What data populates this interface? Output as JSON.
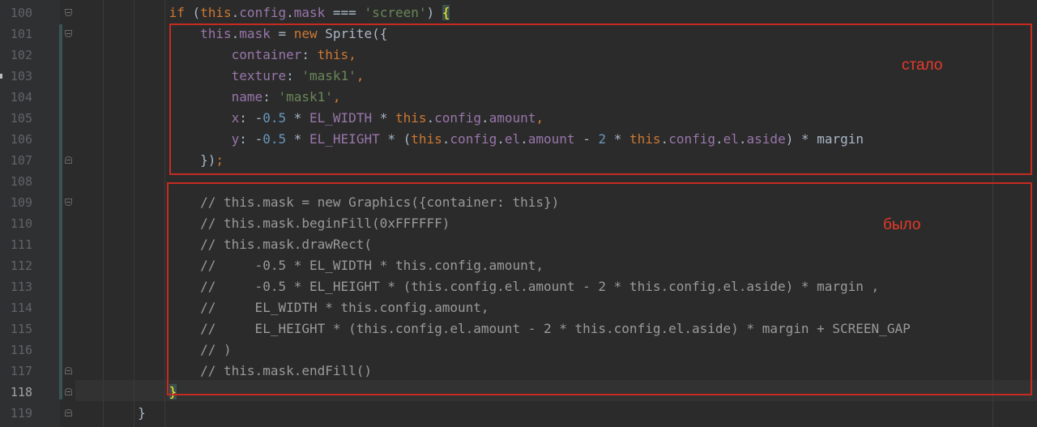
{
  "editor": {
    "current_line": "118",
    "lines": [
      {
        "num": "100",
        "tokens": [
          [
            "",
            "            "
          ],
          [
            "kw",
            "if"
          ],
          [
            "",
            " ("
          ],
          [
            "this",
            "this"
          ],
          [
            "",
            "."
          ],
          [
            "prop",
            "config"
          ],
          [
            "",
            "."
          ],
          [
            "prop",
            "mask"
          ],
          [
            "",
            " === "
          ],
          [
            "str",
            "'screen'"
          ],
          [
            "",
            ") "
          ],
          [
            "brace",
            "{"
          ]
        ]
      },
      {
        "num": "101",
        "tokens": [
          [
            "",
            "                "
          ],
          [
            "prop",
            "this"
          ],
          [
            "",
            "."
          ],
          [
            "prop",
            "mask"
          ],
          [
            "",
            " = "
          ],
          [
            "kw",
            "new"
          ],
          [
            "",
            " Sprite({"
          ]
        ]
      },
      {
        "num": "102",
        "tokens": [
          [
            "",
            "                    "
          ],
          [
            "prop",
            "container"
          ],
          [
            "",
            ": "
          ],
          [
            "this",
            "this"
          ],
          [
            "kw",
            ","
          ]
        ]
      },
      {
        "num": "103",
        "tokens": [
          [
            "",
            "                    "
          ],
          [
            "prop",
            "texture"
          ],
          [
            "",
            ": "
          ],
          [
            "str",
            "'mask1'"
          ],
          [
            "kw",
            ","
          ]
        ]
      },
      {
        "num": "104",
        "tokens": [
          [
            "",
            "                    "
          ],
          [
            "prop",
            "name"
          ],
          [
            "",
            ": "
          ],
          [
            "str",
            "'mask1'"
          ],
          [
            "kw",
            ","
          ]
        ]
      },
      {
        "num": "105",
        "tokens": [
          [
            "",
            "                    "
          ],
          [
            "prop",
            "x"
          ],
          [
            "",
            ": -"
          ],
          [
            "num",
            "0.5"
          ],
          [
            "",
            " * "
          ],
          [
            "prop",
            "EL_WIDTH"
          ],
          [
            "",
            " * "
          ],
          [
            "this",
            "this"
          ],
          [
            "",
            "."
          ],
          [
            "prop",
            "config"
          ],
          [
            "",
            "."
          ],
          [
            "prop",
            "amount"
          ],
          [
            "kw",
            ","
          ]
        ]
      },
      {
        "num": "106",
        "tokens": [
          [
            "",
            "                    "
          ],
          [
            "prop",
            "y"
          ],
          [
            "",
            ": -"
          ],
          [
            "num",
            "0.5"
          ],
          [
            "",
            " * "
          ],
          [
            "prop",
            "EL_HEIGHT"
          ],
          [
            "",
            " * ("
          ],
          [
            "this",
            "this"
          ],
          [
            "",
            "."
          ],
          [
            "prop",
            "config"
          ],
          [
            "",
            "."
          ],
          [
            "prop",
            "el"
          ],
          [
            "",
            "."
          ],
          [
            "prop",
            "amount"
          ],
          [
            "",
            " - "
          ],
          [
            "num",
            "2"
          ],
          [
            "",
            " * "
          ],
          [
            "this",
            "this"
          ],
          [
            "",
            "."
          ],
          [
            "prop",
            "config"
          ],
          [
            "",
            "."
          ],
          [
            "prop",
            "el"
          ],
          [
            "",
            "."
          ],
          [
            "prop",
            "aside"
          ],
          [
            "",
            ") * margin"
          ]
        ]
      },
      {
        "num": "107",
        "tokens": [
          [
            "",
            "                "
          ],
          [
            "",
            "})"
          ],
          [
            "kw",
            ";"
          ]
        ]
      },
      {
        "num": "108",
        "tokens": []
      },
      {
        "num": "109",
        "tokens": [
          [
            "",
            "                "
          ],
          [
            "cm",
            "// this.mask = new Graphics({container: this})"
          ]
        ]
      },
      {
        "num": "110",
        "tokens": [
          [
            "",
            "                "
          ],
          [
            "cm",
            "// this.mask.beginFill(0xFFFFFF)"
          ]
        ]
      },
      {
        "num": "111",
        "tokens": [
          [
            "",
            "                "
          ],
          [
            "cm",
            "// this.mask.drawRect("
          ]
        ]
      },
      {
        "num": "112",
        "tokens": [
          [
            "",
            "                "
          ],
          [
            "cm",
            "//     -0.5 * EL_WIDTH * this.config.amount,"
          ]
        ]
      },
      {
        "num": "113",
        "tokens": [
          [
            "",
            "                "
          ],
          [
            "cm",
            "//     -0.5 * EL_HEIGHT * (this.config.el.amount - 2 * this.config.el.aside) * margin ,"
          ]
        ]
      },
      {
        "num": "114",
        "tokens": [
          [
            "",
            "                "
          ],
          [
            "cm",
            "//     EL_WIDTH * this.config.amount,"
          ]
        ]
      },
      {
        "num": "115",
        "tokens": [
          [
            "",
            "                "
          ],
          [
            "cm",
            "//     EL_HEIGHT * (this.config.el.amount - 2 * this.config.el.aside) * margin + SCREEN_GAP"
          ]
        ]
      },
      {
        "num": "116",
        "tokens": [
          [
            "",
            "                "
          ],
          [
            "cm",
            "// )"
          ]
        ]
      },
      {
        "num": "117",
        "tokens": [
          [
            "",
            "                "
          ],
          [
            "cm",
            "// this.mask.endFill()"
          ]
        ]
      },
      {
        "num": "118",
        "tokens": [
          [
            "",
            "            "
          ],
          [
            "brace",
            "}"
          ]
        ]
      },
      {
        "num": "119",
        "tokens": [
          [
            "",
            "        "
          ],
          [
            "",
            "}"
          ]
        ]
      }
    ]
  },
  "annotations": {
    "new_label": "стало",
    "old_label": "было"
  },
  "colors": {
    "annotation_red": "#c62b22",
    "keyword": "#cc7832",
    "property": "#9876aa",
    "string": "#6a8759",
    "number": "#6897bb",
    "comment": "#9a9a9a"
  }
}
